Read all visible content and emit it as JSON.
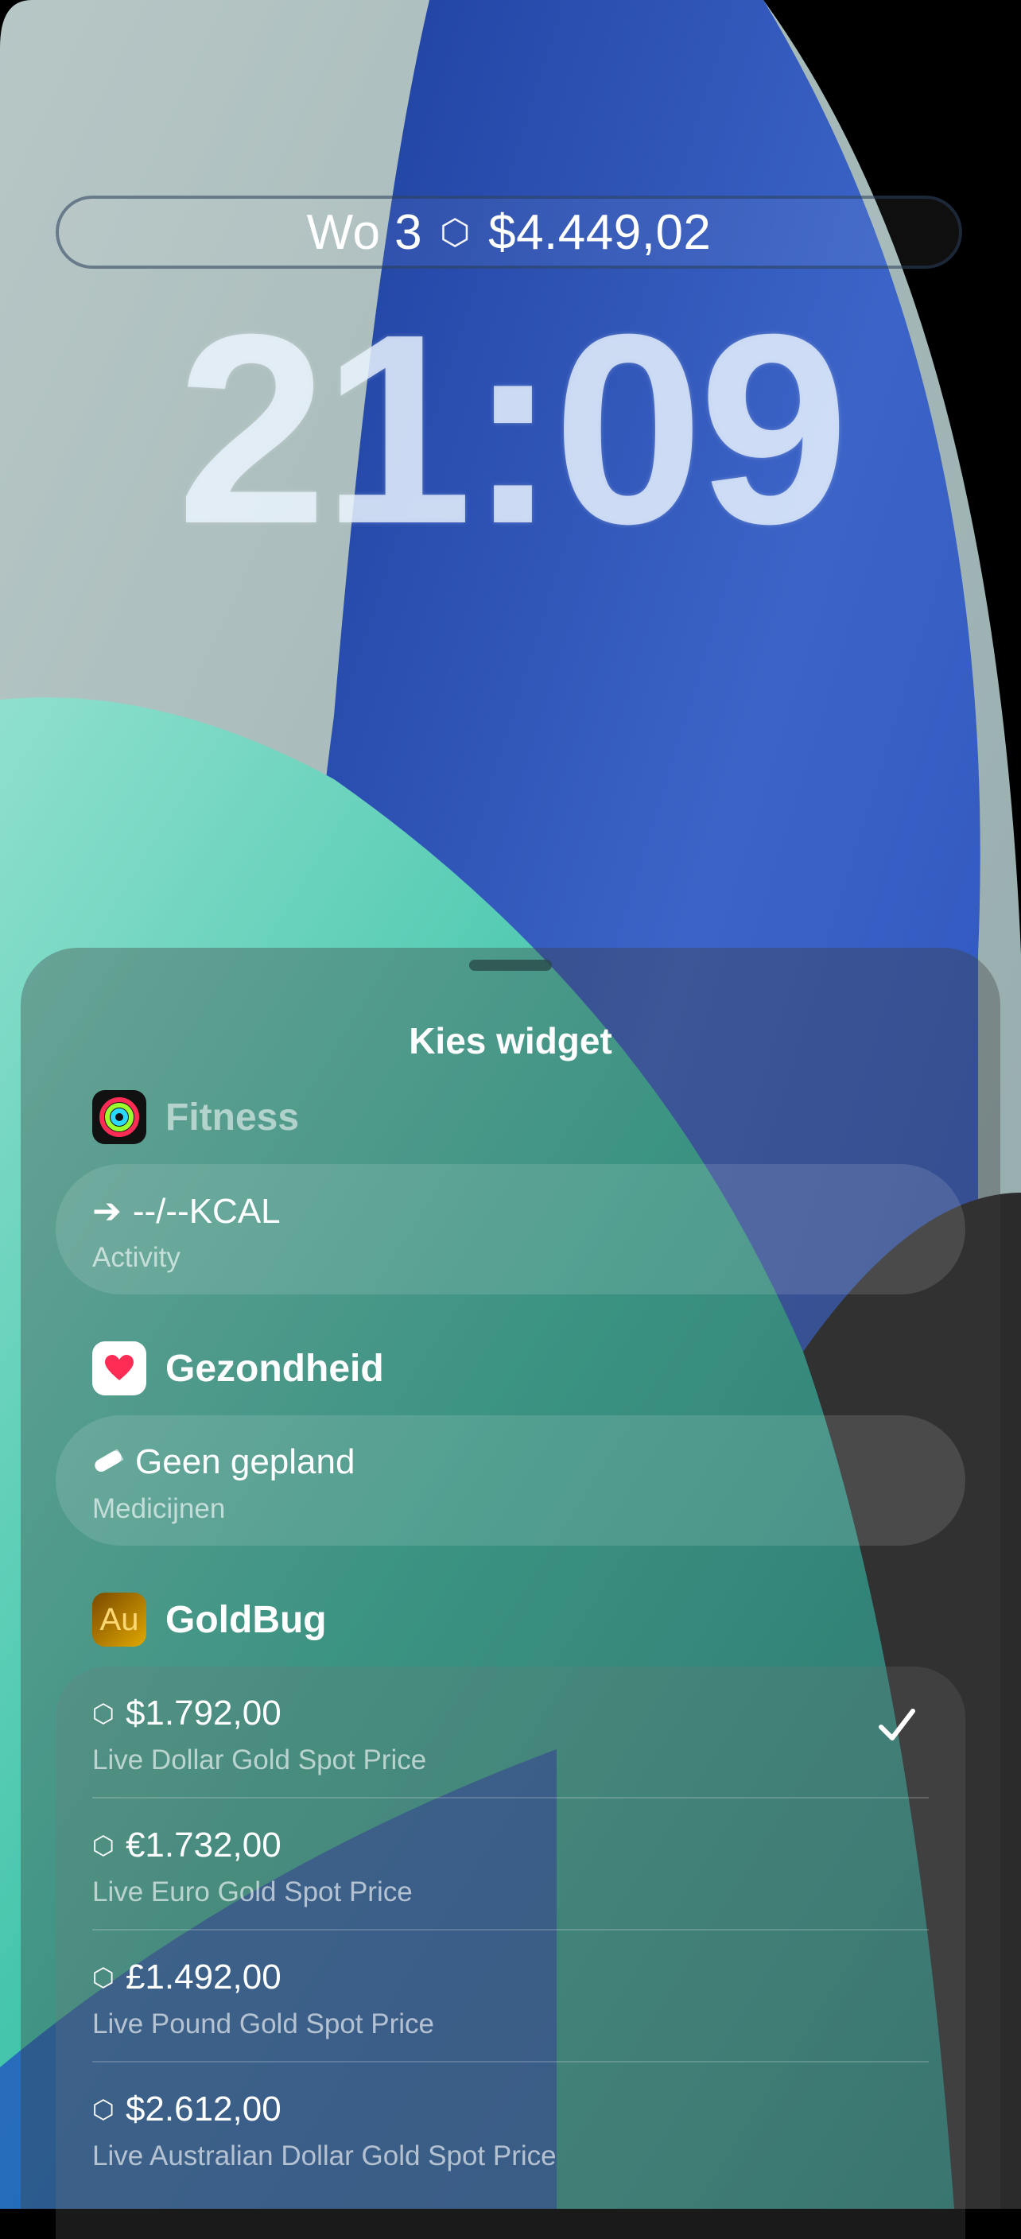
{
  "lockscreen": {
    "date": "Wo 3",
    "widget_icon": "hexagon-icon",
    "gold_price": "$4.449,02",
    "time": "21:09"
  },
  "sheet": {
    "title": "Kies widget",
    "sections": [
      {
        "app": "Fitness",
        "icon": "activity-rings-icon",
        "widgets": [
          {
            "value": "--/--KCAL",
            "label": "Activity",
            "icon": "arrow-right-icon"
          }
        ]
      },
      {
        "app": "Gezondheid",
        "icon": "heart-icon",
        "widgets": [
          {
            "value": "Geen gepland",
            "label": "Medicijnen",
            "icon": "pill-icon"
          }
        ]
      },
      {
        "app": "GoldBug",
        "icon_text": "Au",
        "widgets": [
          {
            "value": "$1.792,00",
            "label": "Live Dollar Gold Spot Price",
            "selected": true
          },
          {
            "value": "€1.732,00",
            "label": "Live Euro Gold Spot Price"
          },
          {
            "value": "£1.492,00",
            "label": "Live Pound Gold Spot Price"
          },
          {
            "value": "$2.612,00",
            "label": "Live Australian Dollar Gold Spot Price"
          }
        ]
      }
    ]
  },
  "colors": {
    "blue_accent": "#2e5bd8",
    "teal_accent": "#3fc4a8",
    "sheet_text": "#ffffff"
  }
}
